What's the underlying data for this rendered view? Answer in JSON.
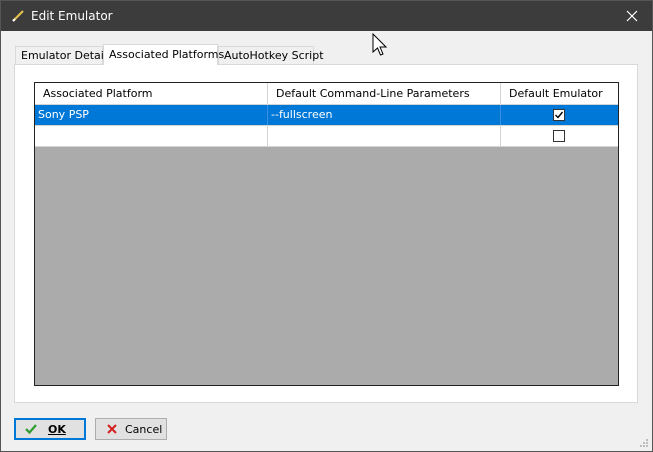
{
  "window": {
    "title": "Edit Emulator"
  },
  "tabs": [
    {
      "label": "Emulator Details",
      "active": false
    },
    {
      "label": "Associated Platforms",
      "active": true
    },
    {
      "label": "AutoHotkey Script",
      "active": false
    }
  ],
  "grid": {
    "columns": [
      "Associated Platform",
      "Default Command-Line Parameters",
      "Default Emulator"
    ],
    "rows": [
      {
        "platform": "Sony PSP",
        "params": "--fullscreen",
        "default": true,
        "selected": true
      },
      {
        "platform": "",
        "params": "",
        "default": false,
        "selected": false
      }
    ]
  },
  "buttons": {
    "ok_label": "OK",
    "cancel_label": "Cancel"
  },
  "colors": {
    "titlebar": "#3c3c3c",
    "selection": "#0078d7",
    "grid_background": "#ababab"
  }
}
